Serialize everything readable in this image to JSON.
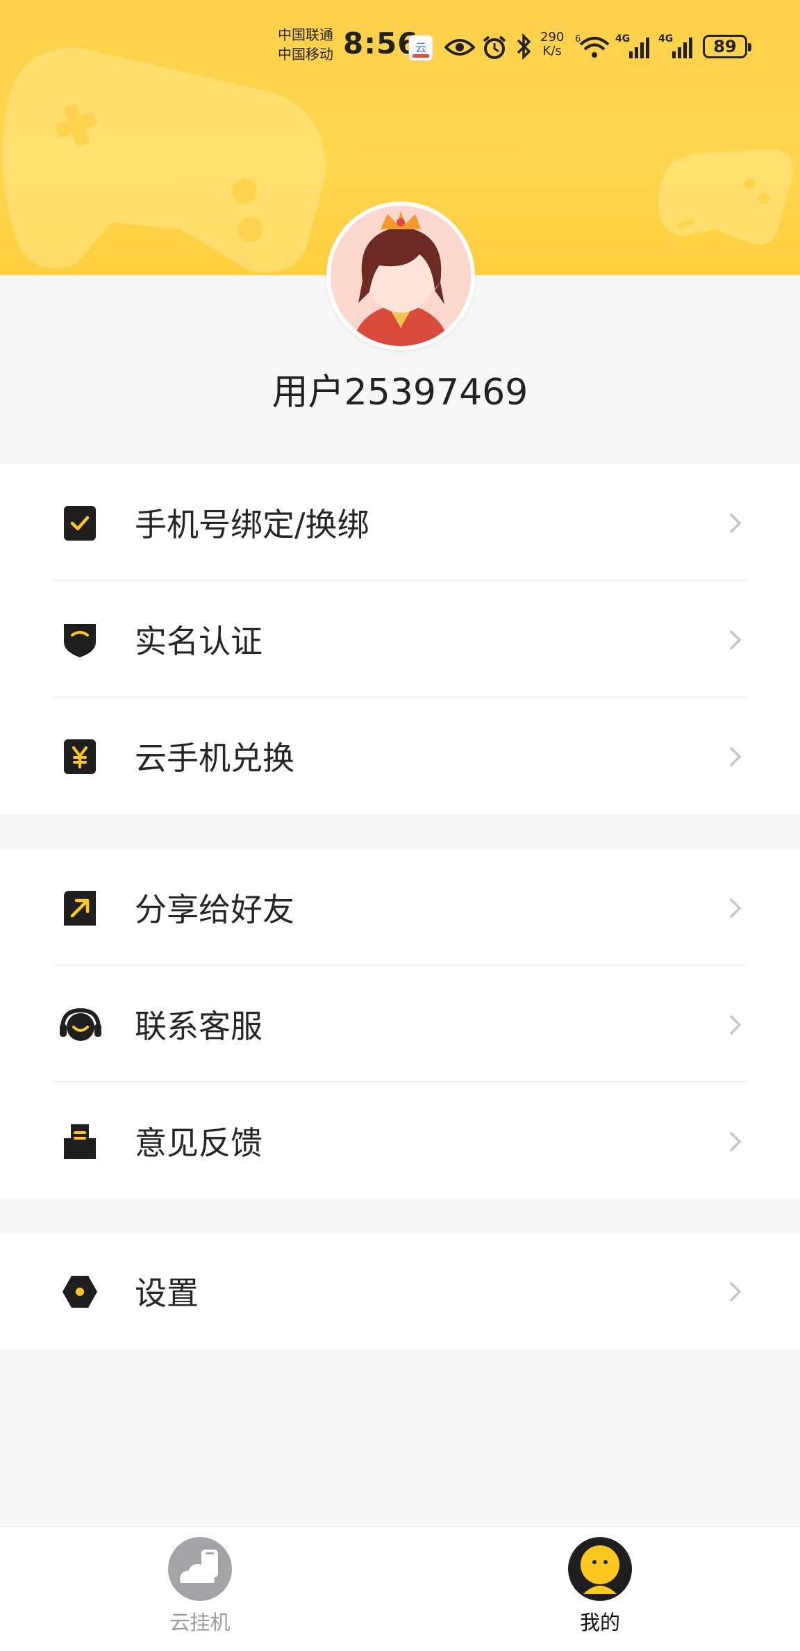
{
  "status_bar": {
    "carrier_1": "中国联通",
    "carrier_2": "中国移动",
    "time": "8:56",
    "net_speed_value": "290",
    "net_speed_unit": "K/s",
    "battery_level": "89",
    "icons": [
      "cloud-app-icon",
      "eye-icon",
      "alarm-icon",
      "bluetooth-icon",
      "wifi-icon",
      "signal-4g-icon",
      "signal-4g-icon"
    ]
  },
  "profile": {
    "username": "用户25397469"
  },
  "menu": {
    "group_1": [
      {
        "label": "手机号绑定/换绑",
        "icon": "phone-bind-check-icon"
      },
      {
        "label": "实名认证",
        "icon": "shield-icon"
      },
      {
        "label": "云手机兑换",
        "icon": "yen-icon"
      }
    ],
    "group_2": [
      {
        "label": "分享给好友",
        "icon": "share-arrow-icon"
      },
      {
        "label": "联系客服",
        "icon": "headset-icon"
      },
      {
        "label": "意见反馈",
        "icon": "feedback-icon"
      }
    ],
    "group_3": [
      {
        "label": "设置",
        "icon": "settings-hexagon-icon"
      }
    ]
  },
  "bottom_nav": {
    "tabs": [
      {
        "label": "云挂机",
        "icon": "cloud-phone-icon",
        "active": false
      },
      {
        "label": "我的",
        "icon": "mascot-face-icon",
        "active": true
      }
    ]
  },
  "colors": {
    "header_yellow": "#ffd24a",
    "accent_yellow": "#ffc81f",
    "icon_dark": "#1f1f1f",
    "page_bg": "#f6f6f6"
  }
}
